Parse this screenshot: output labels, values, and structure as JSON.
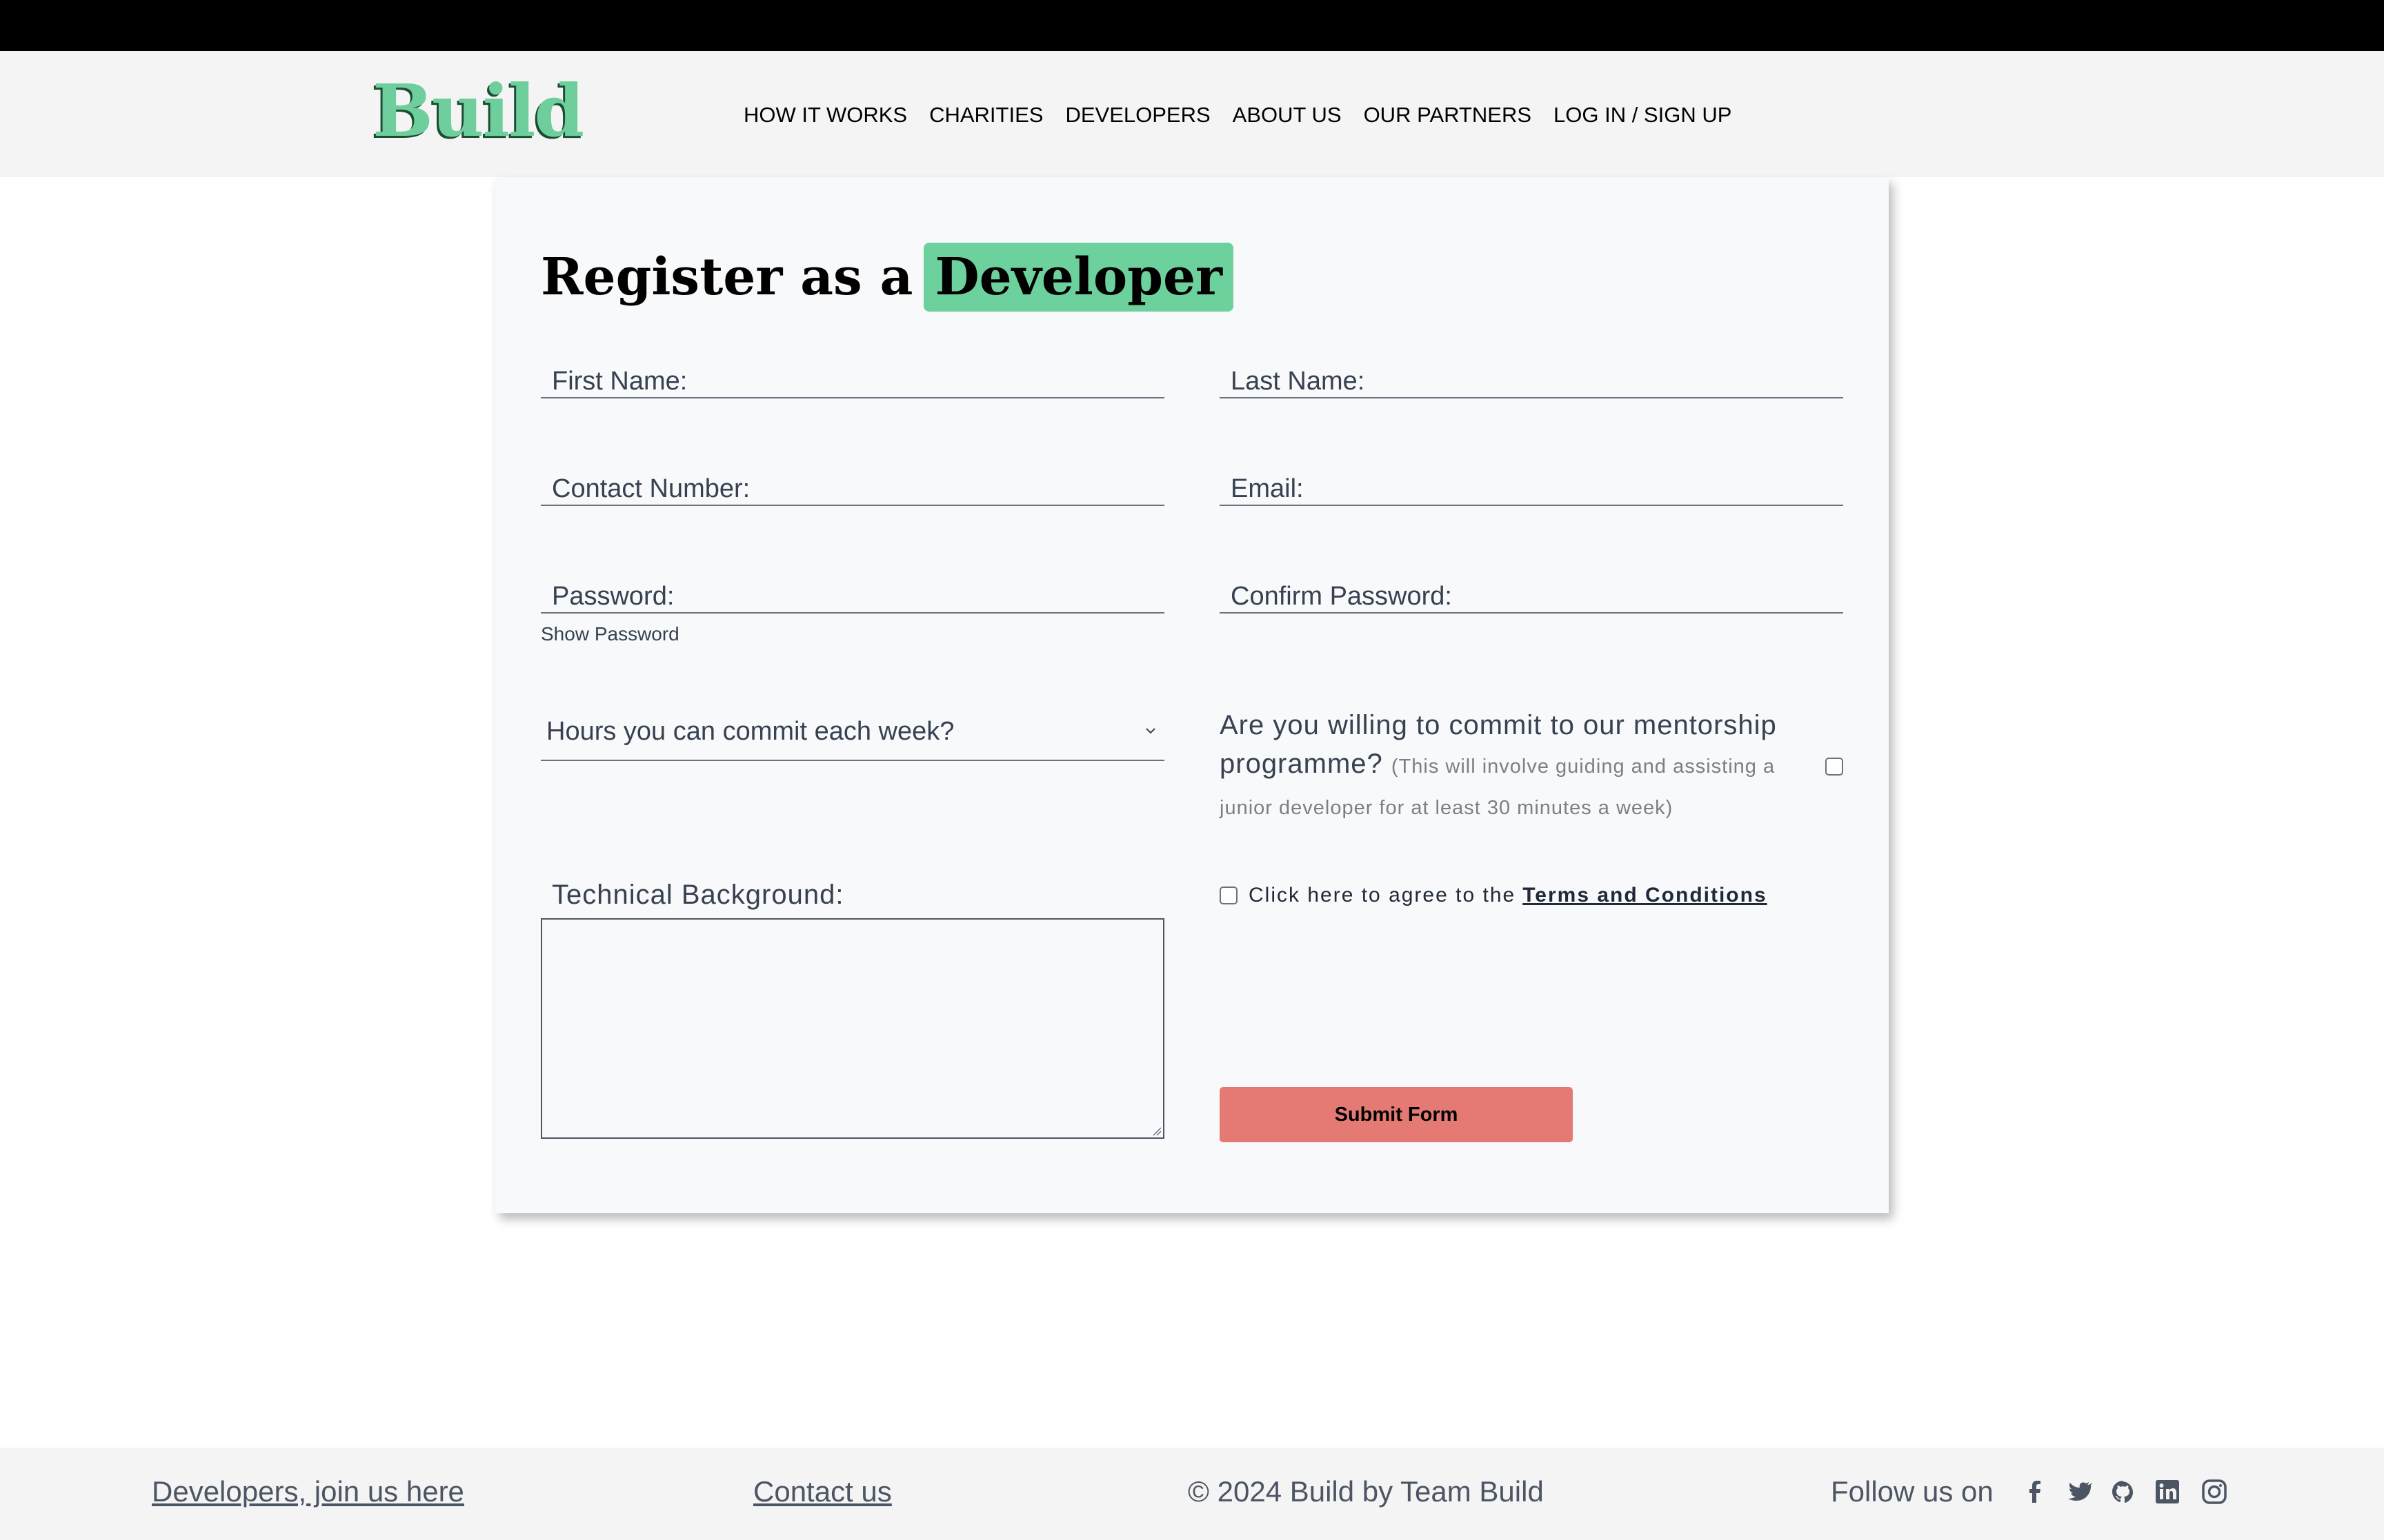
{
  "header": {
    "logo": "Build",
    "nav": [
      "HOW IT WORKS",
      "CHARITIES",
      "DEVELOPERS",
      "ABOUT US",
      "OUR PARTNERS",
      "LOG IN / SIGN UP"
    ]
  },
  "form": {
    "title_prefix": "Register as a",
    "title_highlight": "Developer",
    "first_name_placeholder": "First Name:",
    "last_name_placeholder": "Last Name:",
    "contact_placeholder": "Contact Number:",
    "email_placeholder": "Email:",
    "password_placeholder": "Password:",
    "confirm_password_placeholder": "Confirm Password:",
    "show_password": "Show Password",
    "hours_select": "Hours you can commit each week?",
    "mentorship_question": "Are you willing to commit to our mentorship programme?",
    "mentorship_note": "(This will involve guiding and assisting a junior developer for at least 30 minutes a week)",
    "terms_prefix": "Click here to agree to the",
    "terms_link": "Terms and Conditions",
    "tech_label": "Technical Background:",
    "submit": "Submit Form"
  },
  "footer": {
    "join": "Developers, join us here",
    "contact": "Contact us",
    "copyright": "© 2024 Build by Team Build",
    "follow": "Follow us on",
    "social_icons": [
      "facebook-icon",
      "twitter-icon",
      "github-icon",
      "linkedin-icon",
      "instagram-icon"
    ]
  },
  "colors": {
    "accent_green": "#6dd19e",
    "submit_red": "#e57a74",
    "header_bg": "#f4f4f4",
    "card_bg": "#f8f9fa"
  }
}
